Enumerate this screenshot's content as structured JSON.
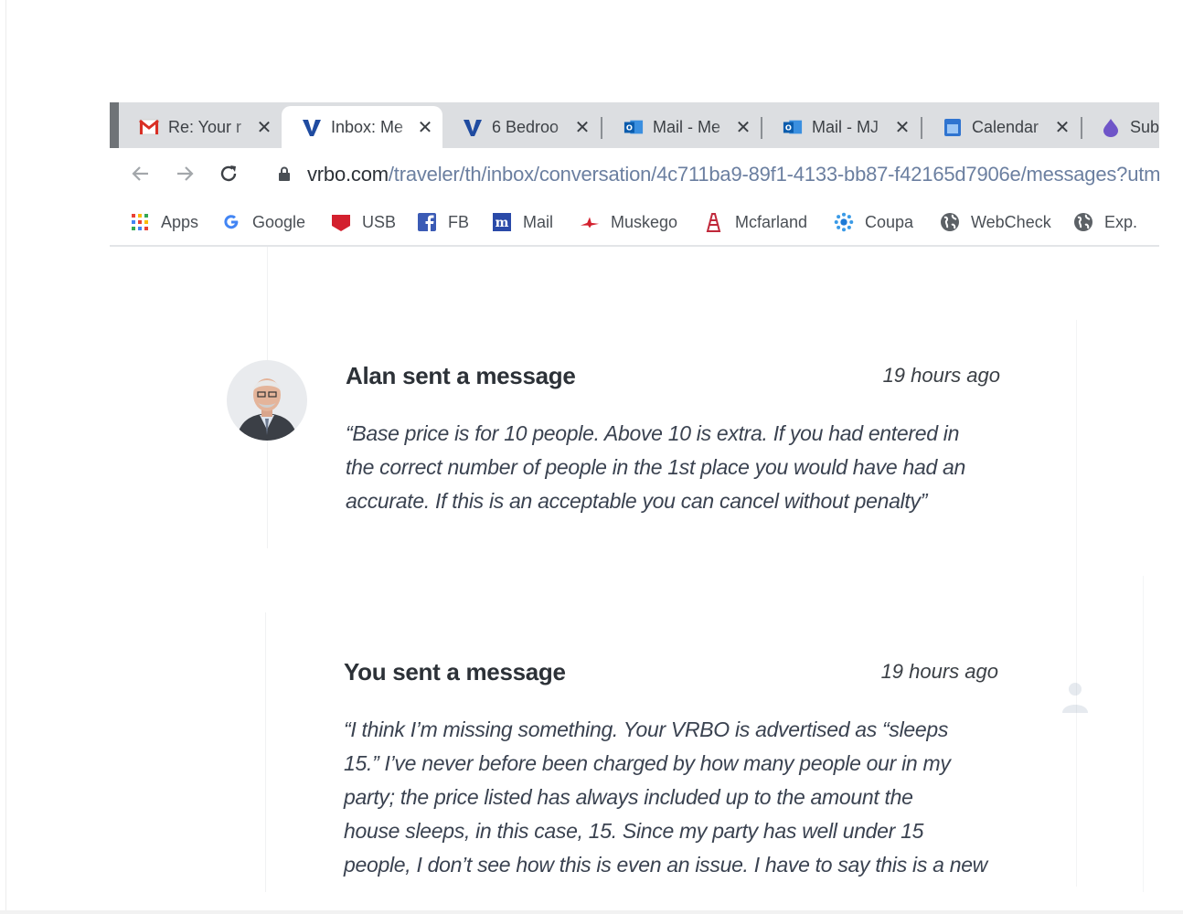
{
  "browser": {
    "tabs": [
      {
        "title": "Re: Your r",
        "icon": "gmail-icon"
      },
      {
        "title": "Inbox: Me",
        "icon": "vrbo-icon"
      },
      {
        "title": "6 Bedroo",
        "icon": "vrbo-icon"
      },
      {
        "title": "Mail - Me",
        "icon": "outlook-icon"
      },
      {
        "title": "Mail - MJ",
        "icon": "outlook-icon"
      },
      {
        "title": "Calendar",
        "icon": "calendar-icon"
      },
      {
        "title": "Sub",
        "icon": "drop-icon"
      }
    ],
    "close_glyph": "✕",
    "url_host": "vrbo.com",
    "url_path": "/traveler/th/inbox/conversation/4c711ba9-89f1-4133-bb87-f42165d7906e/messages?utm",
    "bookmarks": [
      {
        "label": "Apps",
        "icon": "apps-grid-icon"
      },
      {
        "label": "Google",
        "icon": "google-icon"
      },
      {
        "label": "USB",
        "icon": "usb-icon"
      },
      {
        "label": "FB",
        "icon": "facebook-icon"
      },
      {
        "label": "Mail",
        "icon": "m-mail-icon"
      },
      {
        "label": "Muskego",
        "icon": "muskego-icon"
      },
      {
        "label": "Mcfarland",
        "icon": "mcfarland-icon"
      },
      {
        "label": "Coupa",
        "icon": "coupa-icon"
      },
      {
        "label": "WebCheck",
        "icon": "globe-icon"
      },
      {
        "label": "Exp.",
        "icon": "globe-icon"
      }
    ]
  },
  "messages": [
    {
      "title": "Alan sent a message",
      "time": "19 hours ago",
      "lines": [
        "“Base price is for 10 people. Above 10 is extra. If you had entered in",
        "the correct number of people in the 1st place you would have had an",
        "accurate. If this is an acceptable you can cancel without penalty”"
      ]
    },
    {
      "title": "You sent a message",
      "time": "19 hours ago",
      "lines": [
        "“I think I’m missing something. Your VRBO is advertised as “sleeps",
        "15.” I’ve never before been charged by how many people our in my",
        "party; the price listed has always included up to the amount the",
        "house sleeps, in this case, 15. Since my party has well under 15",
        "people, I don’t see how this is even an issue. I have to say this is a new"
      ]
    }
  ]
}
